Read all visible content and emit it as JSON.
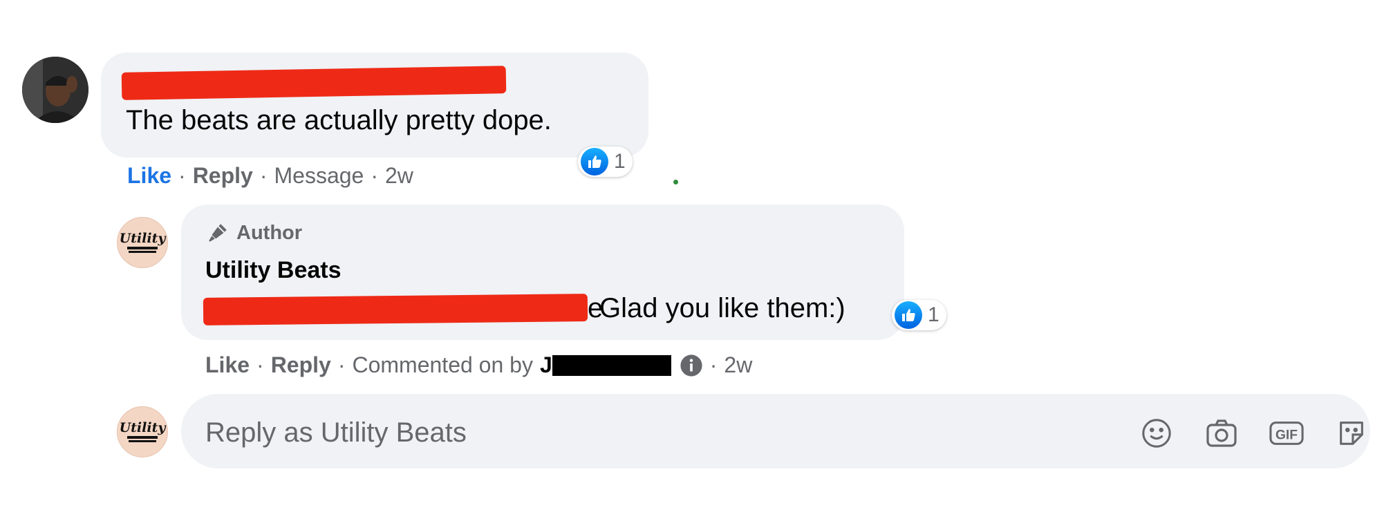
{
  "colors": {
    "bubble_bg": "#f0f2f5",
    "link_blue": "#1b74e4",
    "muted_text": "#65676b",
    "like_blue": "#0062e0",
    "redaction_red": "#ee2a17"
  },
  "comment": {
    "text": "The beats are actually pretty dope.",
    "reaction_count": "1",
    "actions": {
      "like": "Like",
      "reply": "Reply",
      "message": "Message",
      "time": "2w"
    }
  },
  "reply": {
    "author_tag": "Author",
    "author_name": "Utility Beats",
    "text": "Glad you like them:)",
    "text_fragment_left": "e",
    "reaction_count": "1",
    "actions": {
      "like": "Like",
      "reply": "Reply",
      "commented_on_by": "Commented on by",
      "commenter_initial": "J",
      "time": "2w"
    }
  },
  "composer": {
    "placeholder": "Reply as Utility Beats",
    "gif_label": "GIF",
    "icons": [
      "emoji-icon",
      "camera-icon",
      "gif-icon",
      "sticker-icon"
    ]
  },
  "avatar_logo_text": "Utility"
}
